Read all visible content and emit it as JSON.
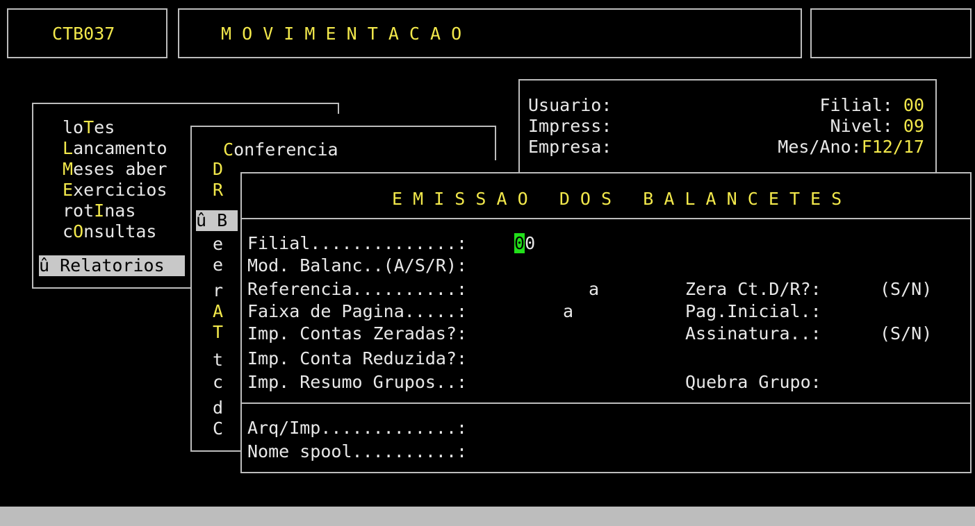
{
  "header": {
    "program_code": "CTB037",
    "title": "M O V I M E N T A C A O",
    "right_box": ""
  },
  "info": {
    "usuario_label": "Usuario:",
    "impress_label": "Impress:",
    "empresa_label": "Empresa:",
    "filial_label": "Filial:",
    "filial_value": "00",
    "nivel_label": "Nivel:",
    "nivel_value": "09",
    "mesano_label": "Mes/Ano:",
    "mesano_value": "F12/17"
  },
  "main_menu": {
    "items": [
      {
        "hot": "",
        "pre": "lo",
        "key": "T",
        "post": "es"
      },
      {
        "hot": "L",
        "pre": "",
        "key": "",
        "post": "ancamento"
      },
      {
        "hot": "M",
        "pre": "",
        "key": "",
        "post": "eses aber"
      },
      {
        "hot": "E",
        "pre": "",
        "key": "",
        "post": "xercicios"
      },
      {
        "hot": "",
        "pre": "rot",
        "key": "I",
        "post": "nas"
      },
      {
        "hot": "",
        "pre": "c",
        "key": "O",
        "post": "nsultas"
      }
    ],
    "selected_marker": "û",
    "selected_label": "Relatorios"
  },
  "sub_menu": {
    "first_hot": "C",
    "first_rest": "onferencia",
    "marker": "û",
    "letters": [
      "D",
      "R",
      "B",
      "e",
      "e",
      "r",
      "A",
      "T",
      "t",
      "c",
      "d",
      "C"
    ]
  },
  "dialog": {
    "title": "E M I S S A O   D O S   B A L A N C E T E S",
    "filial_label": "Filial..............:",
    "filial_cursor": "0",
    "filial_rest": "0",
    "mod_label": "Mod. Balanc..(A/S/R):",
    "ref_label": "Referencia..........:",
    "ref_sep": "a",
    "faixa_label": "Faixa de Pagina.....:",
    "faixa_sep": "a",
    "zeradas_label": "Imp. Contas Zeradas?:",
    "reduzida_label": "Imp. Conta Reduzida?:",
    "resumo_label": "Imp. Resumo Grupos..:",
    "zera_label": "Zera Ct.D/R?:",
    "zera_hint": "(S/N)",
    "pag_label": "Pag.Inicial.:",
    "assin_label": "Assinatura..:",
    "assin_hint": "(S/N)",
    "quebra_label": "Quebra Grupo:",
    "arq_label": "Arq/Imp.............:",
    "spool_label": "Nome spool..........:"
  }
}
